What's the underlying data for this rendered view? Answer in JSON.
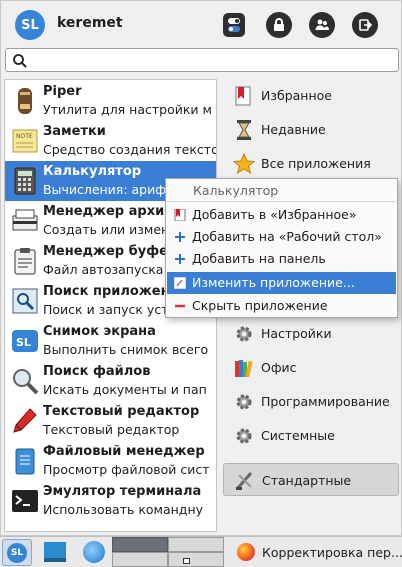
{
  "header": {
    "user_initials": "SL",
    "username": "keremet"
  },
  "search": {
    "placeholder": ""
  },
  "apps": [
    {
      "name": "Piper",
      "desc": "Утилита для настройки м",
      "icon": "piper-icon"
    },
    {
      "name": "Заметки",
      "desc": "Средство создания тексто",
      "icon": "notes-icon"
    },
    {
      "name": "Калькулятор",
      "desc": "Вычисления: арифм",
      "icon": "calculator-icon",
      "selected": true
    },
    {
      "name": "Менеджер архиво",
      "desc": "Создать или измени",
      "icon": "archive-manager-icon"
    },
    {
      "name": "Менеджер буфера",
      "desc": "Файл автозапуска м",
      "icon": "clipboard-icon"
    },
    {
      "name": "Поиск приложени",
      "desc": "Поиск и запуск устa",
      "icon": "app-finder-icon"
    },
    {
      "name": "Снимок экрана",
      "desc": "Выполнить снимок всего",
      "icon": "screenshot-icon"
    },
    {
      "name": "Поиск файлов",
      "desc": "Искать документы и пап",
      "icon": "file-search-icon"
    },
    {
      "name": "Текстовый редактор",
      "desc": "Текстовый редактор",
      "icon": "text-editor-icon"
    },
    {
      "name": "Файловый менеджер",
      "desc": "Просмотр файловой сист",
      "icon": "file-manager-icon"
    },
    {
      "name": "Эмулятор терминала",
      "desc": "Использовать командну",
      "icon": "terminal-icon"
    }
  ],
  "categories": [
    {
      "label": "Избранное",
      "icon": "favorites-icon"
    },
    {
      "label": "Недавние",
      "icon": "hourglass-icon"
    },
    {
      "label": "Все приложения",
      "icon": "star-icon"
    },
    {
      "label": "",
      "icon": ""
    },
    {
      "label": "",
      "icon": ""
    },
    {
      "label": "",
      "icon": ""
    },
    {
      "label": "Настройки",
      "icon": "settings-gear-icon"
    },
    {
      "label": "Офис",
      "icon": "office-books-icon"
    },
    {
      "label": "Программирование",
      "icon": "programming-gear-icon"
    },
    {
      "label": "Системные",
      "icon": "system-gear-icon"
    },
    {
      "label": "Стандартные",
      "icon": "accessories-icon",
      "active": true
    }
  ],
  "context_menu": {
    "title": "Калькулятор",
    "items": [
      {
        "label": "Добавить в «Избранное»",
        "icon": "bookmark-add-icon"
      },
      {
        "label": "Добавить на «Рабочий стол»",
        "icon": "plus-icon"
      },
      {
        "label": "Добавить на панель",
        "icon": "plus-icon"
      },
      {
        "label": "Изменить приложение...",
        "icon": "edit-icon",
        "highlighted": true
      },
      {
        "label": "Скрыть приложение",
        "icon": "minus-icon"
      }
    ]
  },
  "taskbar": {
    "start_initials": "SL",
    "window_title": "Корректировка пер..."
  },
  "colors": {
    "accent": "#3b7fd4",
    "avatar": "#3584d6"
  }
}
